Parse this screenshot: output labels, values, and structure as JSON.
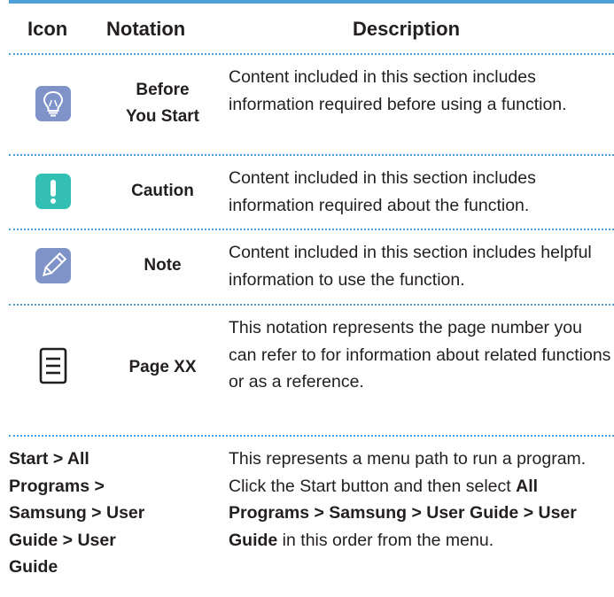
{
  "colors": {
    "accent": "#4f9fd8",
    "icon_blue": "#7f93c8",
    "icon_teal": "#34bfb4"
  },
  "header": {
    "icon": "Icon",
    "notation": "Notation",
    "description": "Description"
  },
  "rows": [
    {
      "icon": "lightbulb-icon",
      "notation_lines": [
        "Before",
        "You Start"
      ],
      "description": "Content included in this section includes information required before using a function."
    },
    {
      "icon": "exclamation-icon",
      "notation_lines": [
        "Caution"
      ],
      "description": "Content included in this section includes information required about the function."
    },
    {
      "icon": "pencil-icon",
      "notation_lines": [
        "Note"
      ],
      "description": "Content included in this section includes helpful information to use the function."
    },
    {
      "icon": "page-icon",
      "notation_lines": [
        "Page XX"
      ],
      "description": "This notation represents the page number you can refer to for information about related functions or as a reference."
    }
  ],
  "menu_row": {
    "path_lines": [
      "Start > All",
      "Programs >",
      "Samsung > User",
      "Guide > User",
      "Guide"
    ],
    "desc_line1": "This represents a menu path to run a program.",
    "desc_intro": "Click the Start button and then select ",
    "desc_bold": "All Programs > Samsung > User Guide > User Guide",
    "desc_outro": " in this order from the menu."
  }
}
